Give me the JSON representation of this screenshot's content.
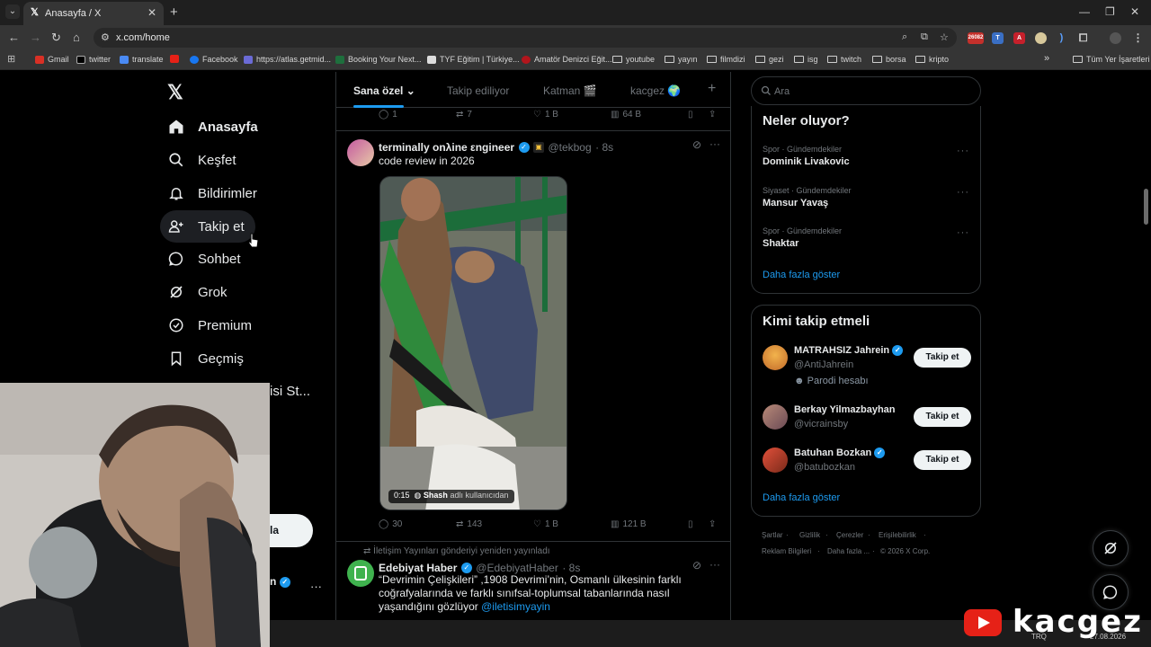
{
  "browser": {
    "tab_title": "Anasayfa / X",
    "url": "x.com/home",
    "ext_badge": "26082",
    "bookmarks": [
      "Gmail",
      "twitter",
      "translate",
      "",
      "Facebook",
      "https://atlas.getmid...",
      "Booking Your Next...",
      "TYF Eğitim | Türkiye...",
      "Amatör Denizci Eğit...",
      "youtube",
      "yayın",
      "filmdizi",
      "gezi",
      "isg",
      "twitch",
      "borsa",
      "kripto"
    ],
    "all_bookmarks": "Tüm Yer İşaretleri",
    "colors": {
      "tabbar": "#1f1f1f",
      "toolbar": "#353535",
      "omnibox": "#282828"
    }
  },
  "nav": {
    "items": [
      {
        "label": "Anasayfa",
        "icon": "home-icon"
      },
      {
        "label": "Keşfet",
        "icon": "search-icon"
      },
      {
        "label": "Bildirimler",
        "icon": "bell-icon"
      },
      {
        "label": "Takip et",
        "icon": "add-user-icon"
      },
      {
        "label": "Sohbet",
        "icon": "chat-icon"
      },
      {
        "label": "Grok",
        "icon": "grok-icon"
      },
      {
        "label": "Premium",
        "icon": "verified-icon"
      },
      {
        "label": "Geçmiş",
        "icon": "bookmark-icon"
      }
    ],
    "partial_item": "isi St...",
    "post_partial": "la",
    "account_partial": "n"
  },
  "feed": {
    "tabs": [
      "Sana özel",
      "Takip ediliyor",
      "Katman 🎬",
      "kacgez 🌍"
    ],
    "top_actions": {
      "replies": "1",
      "reposts": "7",
      "likes": "1 B",
      "views": "64 B"
    },
    "tweet1": {
      "name": "terminally onλine εngineer",
      "handle": "@tekbog",
      "time": "· 8s",
      "text": "code review in 2026",
      "video_time": "0:15",
      "video_user": "Shash",
      "video_suffix": "adlı kullanıcıdan",
      "replies": "30",
      "reposts": "143",
      "likes": "1 B",
      "views": "121 B"
    },
    "tweet2": {
      "repost_label": "İletişim Yayınları gönderiyi yeniden yayınladı",
      "name": "Edebiyat Haber",
      "handle": "@EdebiyatHaber",
      "time": "· 8s",
      "text": "“Devrimin Çelişkileri” ,1908 Devrimi’nin, Osmanlı ülkesinin farklı coğrafyalarında ve farklı sınıfsal-toplumsal tabanlarında nasıl yaşandığını gözlüyor",
      "mention": "@iletisimyayin"
    }
  },
  "right": {
    "search_placeholder": "Ara",
    "trends_title": "Neler oluyor?",
    "trends": [
      {
        "meta": "Spor · Gündemdekiler",
        "name": "Dominik Livakovic"
      },
      {
        "meta": "Siyaset · Gündemdekiler",
        "name": "Mansur Yavaş"
      },
      {
        "meta": "Spor · Gündemdekiler",
        "name": "Shaktar"
      }
    ],
    "show_more": "Daha fazla göster",
    "wtf_title": "Kimi takip etmeli",
    "wtf": [
      {
        "name": "MATRAHSIZ Jahrein",
        "handle": "@AntiJahrein",
        "note": "Parodi hesabı",
        "verified": true
      },
      {
        "name": "Berkay Yilmazbayhan",
        "handle": "@vicrainsby",
        "verified": false
      },
      {
        "name": "Batuhan Bozkan",
        "handle": "@batubozkan",
        "verified": true
      }
    ],
    "follow_label": "Takip et",
    "footer": [
      "Şartlar",
      "Gizlilik",
      "Çerezler",
      "Erişilebilirlik",
      "Reklam Bilgileri",
      "Daha fazla ...",
      "© 2026 X Corp."
    ]
  },
  "watermark": "kacgez",
  "taskbar": {
    "lang": "TRQ",
    "date": "27.08.2026"
  }
}
